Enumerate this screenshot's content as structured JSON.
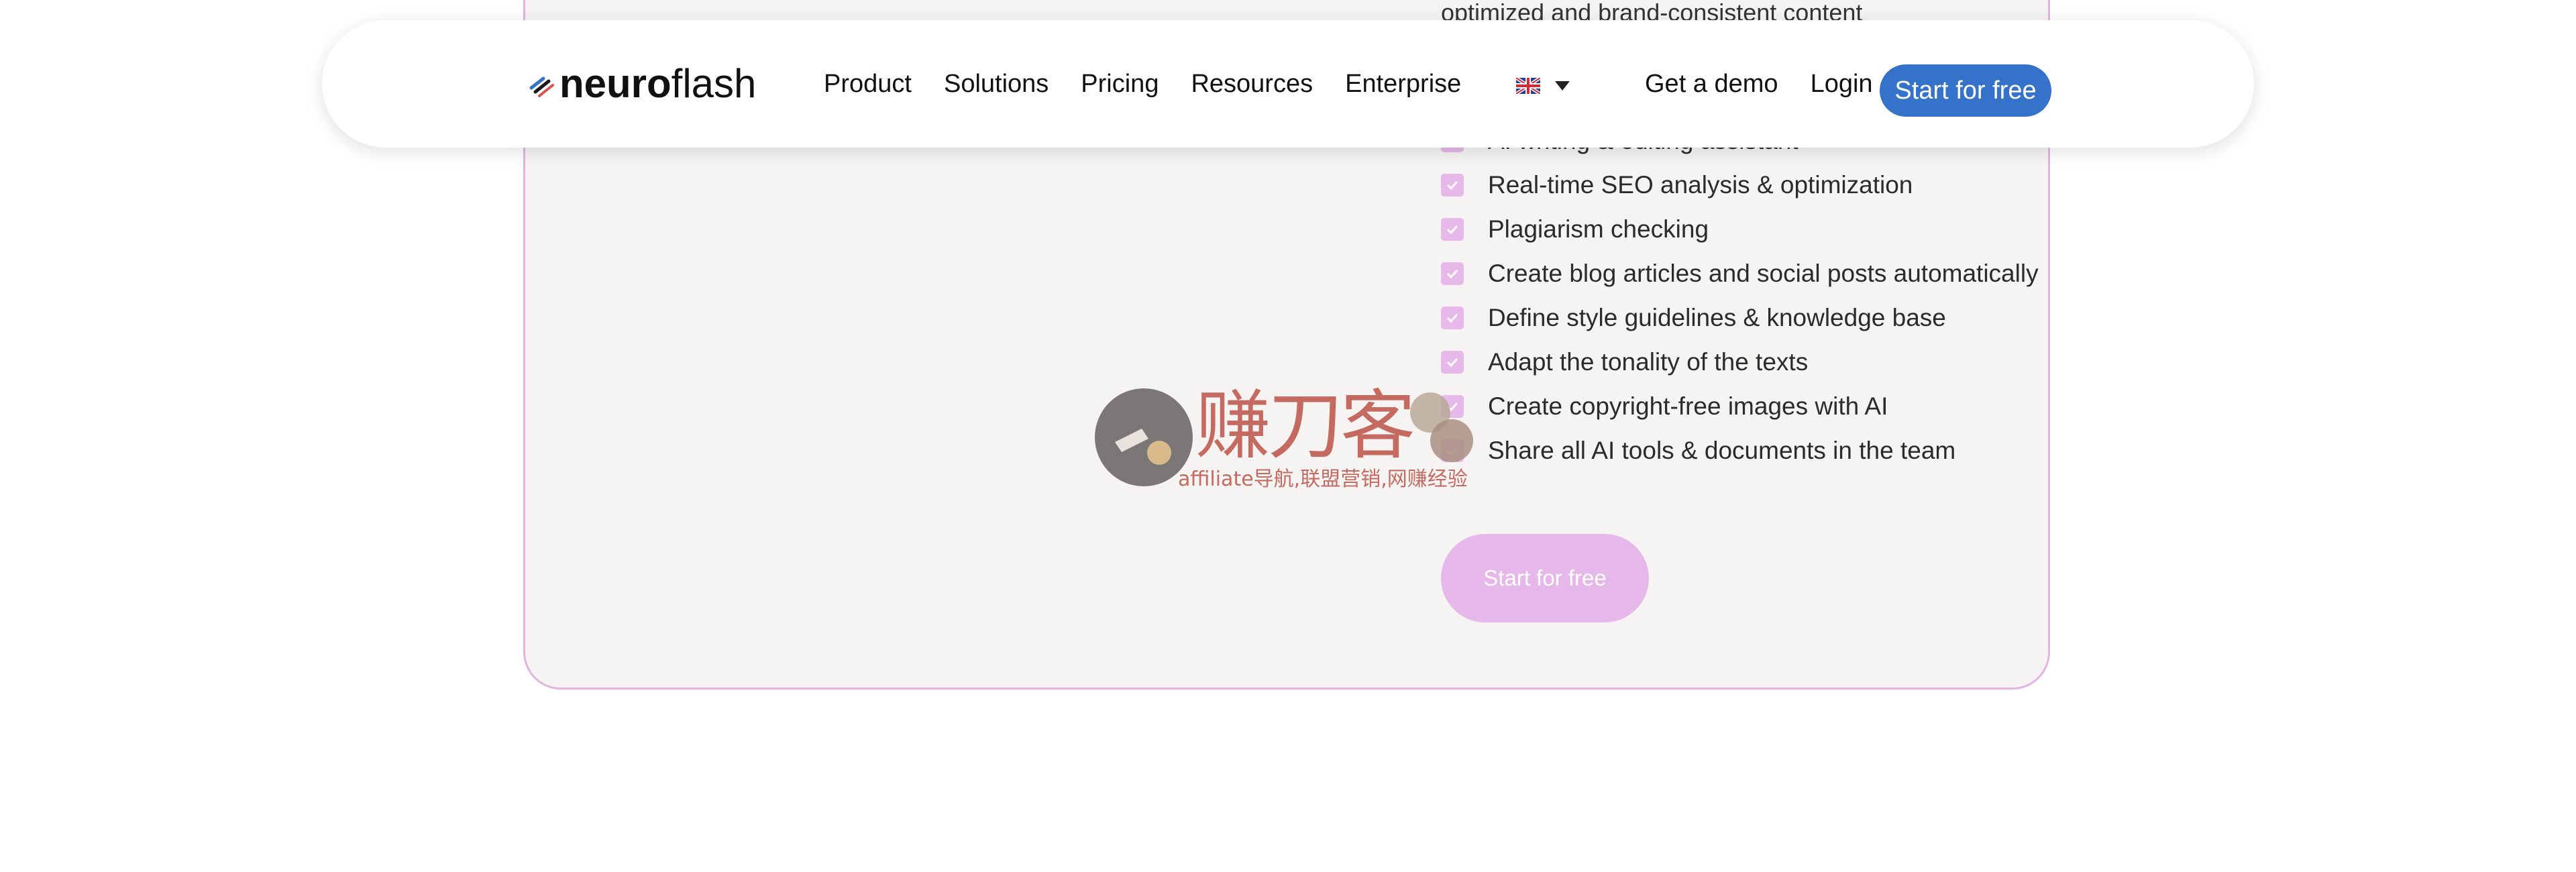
{
  "nav": {
    "logo_bold": "neuro",
    "logo_light": "flash",
    "links": [
      "Product",
      "Solutions",
      "Pricing",
      "Resources",
      "Enterprise"
    ],
    "language_flag": "uk-flag-icon",
    "get_demo": "Get a demo",
    "login": "Login",
    "cta": "Start for free"
  },
  "card": {
    "description_partial": "optimized and brand-consistent content",
    "features": [
      "AI writing & editing assistant",
      "Real-time SEO analysis & optimization",
      "Plagiarism checking",
      "Create blog articles and social posts automatically",
      "Define style guidelines & knowledge base",
      "Adapt the tonality of the texts",
      "Create copyright-free images with AI",
      "Share all AI tools & documents in the team"
    ],
    "cta": "Start for free"
  },
  "watermark": {
    "title": "赚刀客",
    "subtitle": "affiliate导航,联盟营销,网赚经验"
  },
  "colors": {
    "brand_blue": "#3572c9",
    "card_accent": "#e6b8e9",
    "card_bg": "#f6f4f3"
  }
}
